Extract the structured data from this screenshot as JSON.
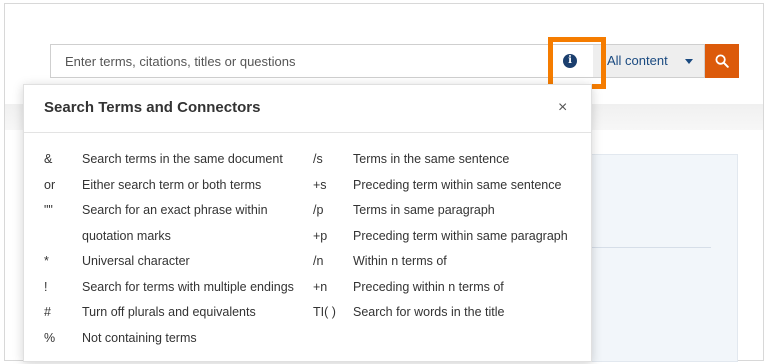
{
  "search": {
    "placeholder": "Enter terms, citations, titles or questions",
    "info_glyph": "i",
    "content_select": "All content"
  },
  "popover": {
    "title": "Search Terms and Connectors",
    "close_glyph": "×",
    "rows": [
      {
        "sym1": "&",
        "desc1": "Search terms in the same document",
        "sym2": "/s",
        "desc2": "Terms in the same sentence"
      },
      {
        "sym1": "or",
        "desc1": "Either search term or both terms",
        "sym2": "+s",
        "desc2": "Preceding term within same sentence"
      },
      {
        "sym1": "\"\"",
        "desc1": "Search for an exact phrase within",
        "sym2": "/p",
        "desc2": "Terms in same paragraph"
      },
      {
        "sym1": "",
        "desc1": "quotation marks",
        "sym2": "+p",
        "desc2": "Preceding term within same paragraph"
      },
      {
        "sym1": "*",
        "desc1": "Universal character",
        "sym2": "/n",
        "desc2": "Within n terms of"
      },
      {
        "sym1": "!",
        "desc1": "Search for terms with multiple endings",
        "sym2": "+n",
        "desc2": "Preceding within n terms of"
      },
      {
        "sym1": "#",
        "desc1": "Turn off plurals and equivalents",
        "sym2": "TI( )",
        "desc2": "Search for words in the title"
      },
      {
        "sym1": "%",
        "desc1": "Not containing terms",
        "sym2": "",
        "desc2": ""
      }
    ]
  },
  "icons": {
    "info": "info-icon",
    "dropdown": "caret-down-icon",
    "search": "search-icon",
    "close": "close-icon"
  },
  "colors": {
    "accent_orange": "#dc5a0a",
    "highlight_orange": "#f57c00",
    "info_navy": "#1b3f6e",
    "link_blue": "#1a4a80"
  }
}
